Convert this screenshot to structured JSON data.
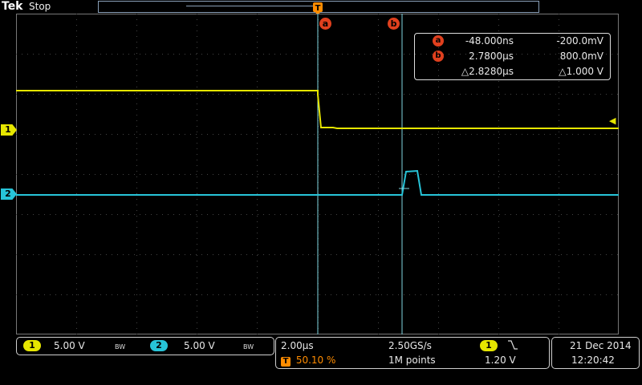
{
  "header": {
    "brand_main": "Tek",
    "status": "Stop"
  },
  "markers": {
    "ch1": "1",
    "ch2": "2"
  },
  "cursors": {
    "a_label": "a",
    "b_label": "b",
    "trigger_icon": "T",
    "readout": {
      "a": {
        "label": "a",
        "time": "-48.000ns",
        "voltage": "-200.0mV"
      },
      "b": {
        "label": "b",
        "time": "2.7800µs",
        "voltage": "800.0mV"
      },
      "delta": {
        "time": "△2.8280µs",
        "voltage": "△1.000 V"
      }
    }
  },
  "channels": {
    "ch1": {
      "label": "1",
      "scale": "5.00 V",
      "bw": "BW",
      "color": "#e6e600"
    },
    "ch2": {
      "label": "2",
      "scale": "5.00 V",
      "bw": "BW",
      "color": "#27c4d8"
    }
  },
  "timebase": {
    "scale": "2.00µs",
    "sample_rate": "2.50GS/s",
    "trigger_position": "50.10 %",
    "record_length": "1M points",
    "trigger_source": "1",
    "trigger_slope_icon": "falling-edge-icon",
    "trigger_level": "1.20 V"
  },
  "datetime": {
    "date": "21 Dec 2014",
    "time": "12:20:42"
  },
  "colors": {
    "cursor": "#e0401e",
    "ch1": "#e6e600",
    "ch2": "#27c4d8",
    "trigger": "#ff8c00"
  }
}
